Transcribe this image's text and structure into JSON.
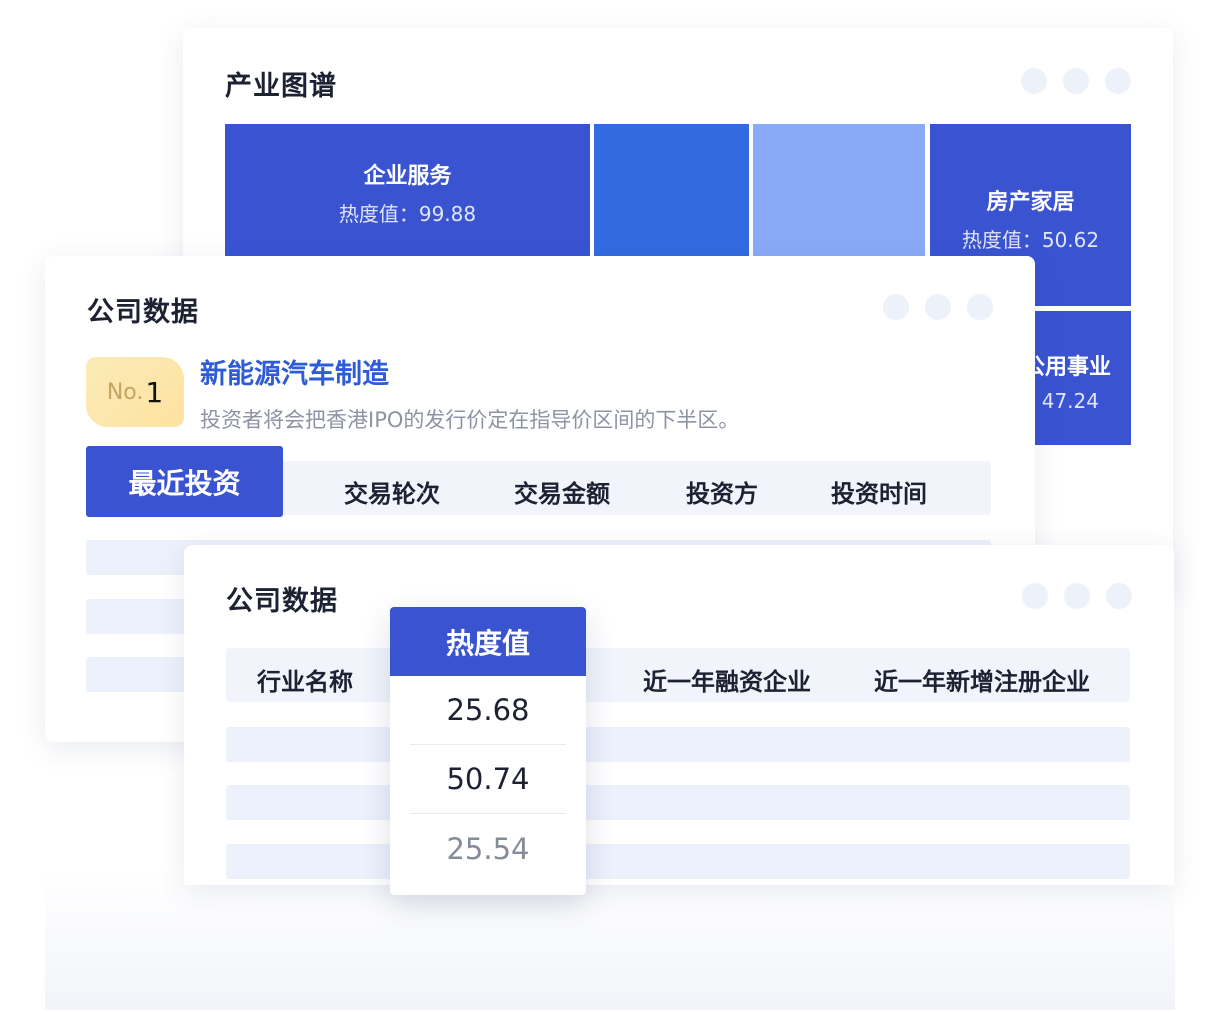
{
  "industry_map": {
    "title": "产业图谱",
    "cells": [
      {
        "name": "企业服务",
        "value_label": "热度值：99.88",
        "color": "#3a54d1"
      },
      {
        "name": "",
        "value_label": "",
        "color": "#326be0"
      },
      {
        "name": "",
        "value_label": "",
        "color": "#8aaaf8"
      },
      {
        "name": "房产家居",
        "value_label": "热度值：50.62",
        "color": "#3a54d1"
      },
      {
        "name": "公用事业",
        "value_label": "47.24",
        "color": "#3a54d1"
      }
    ]
  },
  "company_data": {
    "title": "公司数据",
    "rank_prefix": "No.",
    "rank_number": "1",
    "company_name": "新能源汽车制造",
    "description": "投资者将会把香港IPO的发行价定在指导价区间的下半区。",
    "tab_label": "最近投资",
    "columns": [
      "交易轮次",
      "交易金额",
      "投资方",
      "投资时间"
    ]
  },
  "heat_data": {
    "title": "公司数据",
    "columns": [
      "行业名称",
      "近一年融资企业",
      "近一年新增注册企业"
    ],
    "popup_header": "热度值",
    "popup_values": [
      "25.68",
      "50.74",
      "25.54"
    ]
  },
  "colors": {
    "primary": "#3a54d1",
    "link": "#2e5bd8",
    "badge": "#fde2a0"
  }
}
